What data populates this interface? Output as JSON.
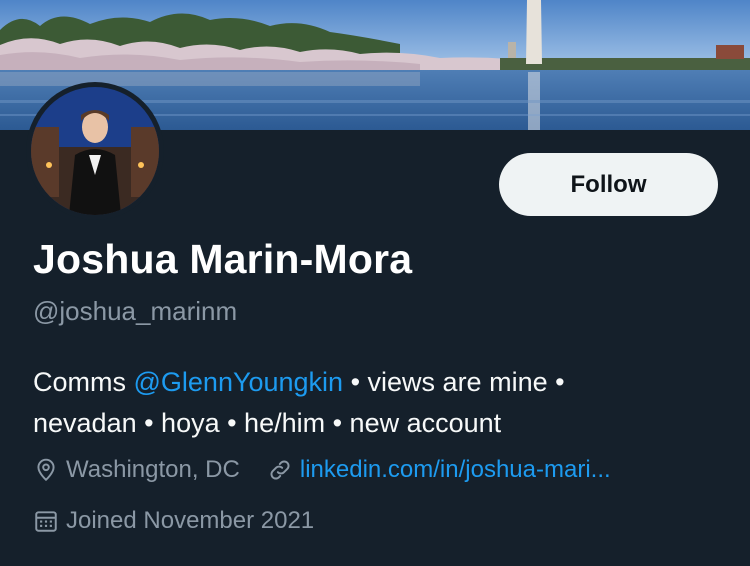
{
  "profile": {
    "display_name": "Joshua Marin-Mora",
    "handle": "@joshua_marinm",
    "follow_label": "Follow",
    "bio": {
      "prefix": "Comms ",
      "mention": "@GlennYoungkin",
      "line1_suffix": " • views are mine •",
      "line2": "nevadan • hoya • he/him • new account"
    },
    "location": "Washington, DC",
    "website": "linkedin.com/in/joshua-mari...",
    "joined": "Joined November 2021"
  },
  "icons": {
    "location": "location-pin-icon",
    "link": "link-icon",
    "calendar": "calendar-icon"
  },
  "colors": {
    "background": "#15202b",
    "accent": "#1d9bf0",
    "secondary_text": "#8b98a5",
    "button_bg": "#eff3f4"
  }
}
